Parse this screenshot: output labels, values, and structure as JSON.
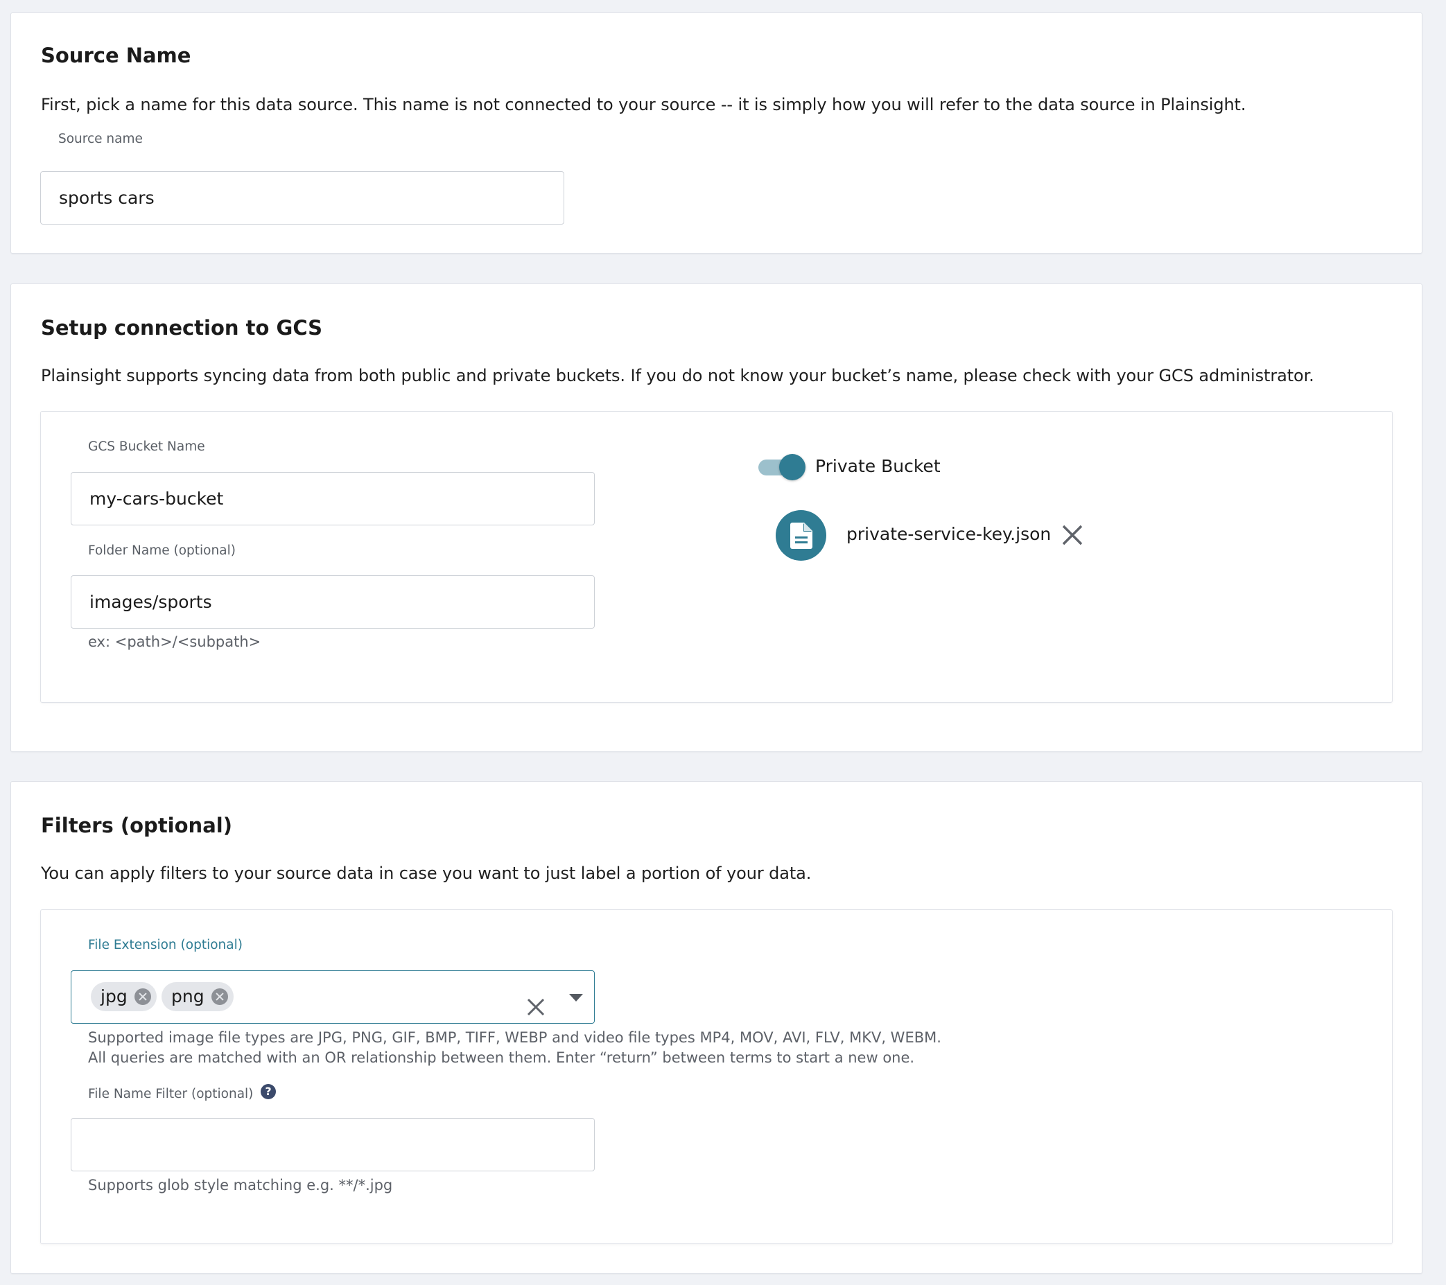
{
  "source_name_section": {
    "title": "Source Name",
    "description": "First, pick a name for this data source. This name is not connected to your source -- it is simply how you will refer to the data source in Plainsight.",
    "field_label": "Source name",
    "field_value": "sports cars"
  },
  "connection_section": {
    "title": "Setup connection to GCS",
    "description": "Plainsight supports syncing data from both public and private buckets. If you do not know your bucket’s name, please check with your GCS administrator.",
    "bucket_label": "GCS Bucket Name",
    "bucket_value": "my-cars-bucket",
    "folder_label": "Folder Name (optional)",
    "folder_value": "images/sports",
    "folder_helper": "ex: <path>/<subpath>",
    "private_toggle_label": "Private Bucket",
    "private_toggle_on": true,
    "file_icon": "document-icon",
    "file_name": "private-service-key.json",
    "remove_icon": "close-icon"
  },
  "filters_section": {
    "title": "Filters (optional)",
    "description": "You can apply filters to your source data in case you want to just label a portion of your data.",
    "extension_label": "File Extension (optional)",
    "extension_chips": [
      "jpg",
      "png"
    ],
    "extension_helper_line1": "Supported image file types are JPG, PNG, GIF, BMP, TIFF, WEBP and video file types MP4, MOV, AVI, FLV, MKV, WEBM.",
    "extension_helper_line2": "All queries are matched with an OR relationship between them. Enter “return” between terms to start a new one.",
    "name_filter_label": "File Name Filter (optional)",
    "name_filter_help_icon": "question-icon",
    "name_filter_help_glyph": "?",
    "name_filter_value": "",
    "name_filter_helper": "Supports glob style matching e.g. **/*.jpg"
  },
  "colors": {
    "accent": "#2f7c93",
    "background": "#f0f2f6",
    "card": "#ffffff"
  }
}
